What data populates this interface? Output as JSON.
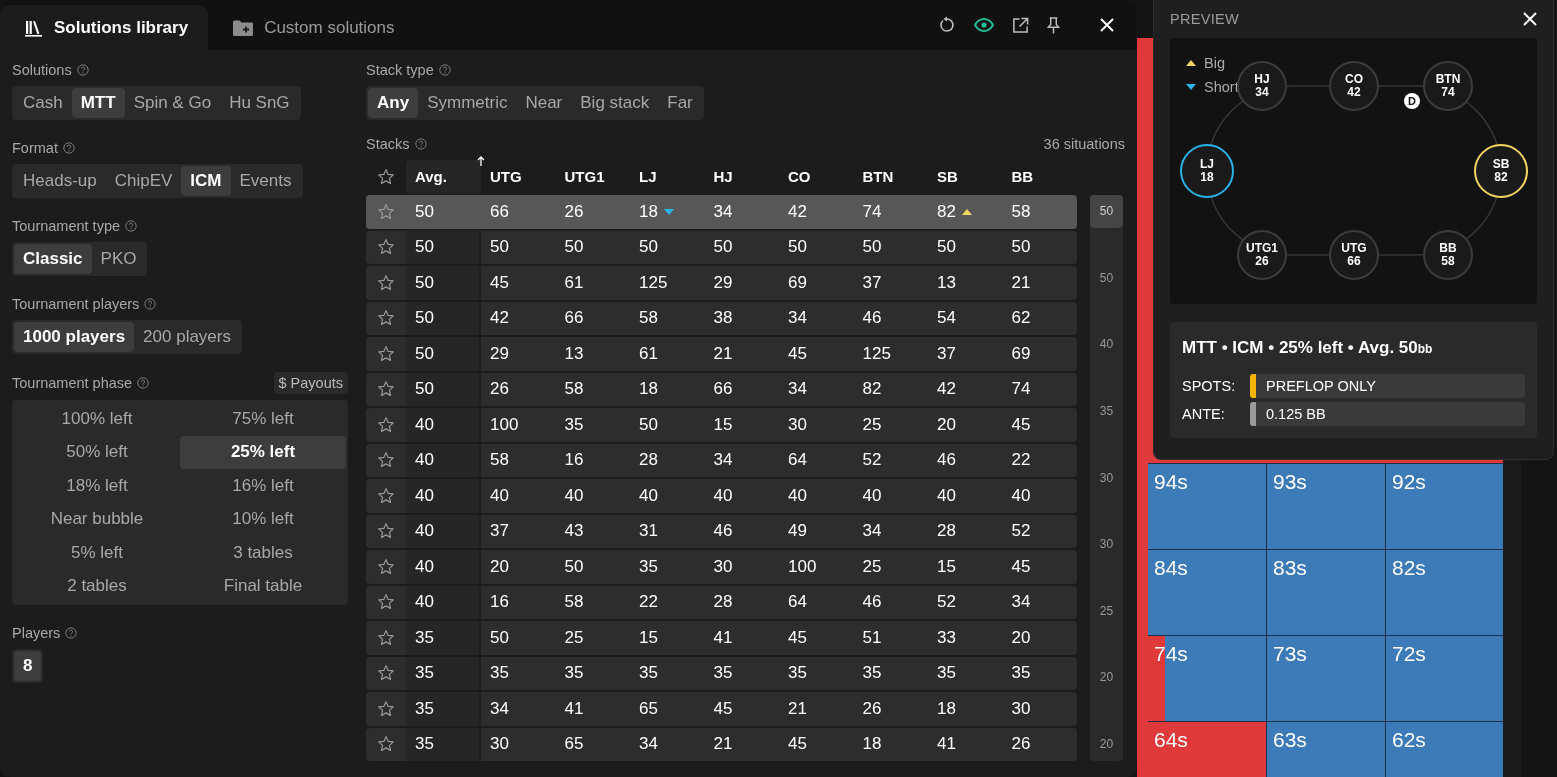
{
  "window": {
    "tabs": [
      {
        "label": "Solutions library",
        "kind": "library",
        "selected": true
      },
      {
        "label": "Custom solutions",
        "kind": "folder",
        "selected": false
      }
    ],
    "toolbar": [
      {
        "kind": "reset",
        "on": false
      },
      {
        "kind": "eye",
        "on": true
      },
      {
        "kind": "external",
        "on": false
      },
      {
        "kind": "pin",
        "on": false
      }
    ]
  },
  "filters": [
    {
      "label": "Solutions",
      "kind": "segmented",
      "options": [
        {
          "label": "Cash",
          "selected": false
        },
        {
          "label": "MTT",
          "selected": true
        },
        {
          "label": "Spin & Go",
          "selected": false
        },
        {
          "label": "Hu SnG",
          "selected": false
        }
      ]
    },
    {
      "label": "Format",
      "kind": "segmented",
      "options": [
        {
          "label": "Heads-up",
          "selected": false
        },
        {
          "label": "ChipEV",
          "selected": false
        },
        {
          "label": "ICM",
          "selected": true
        },
        {
          "label": "Events",
          "selected": false
        }
      ]
    },
    {
      "label": "Tournament type",
      "kind": "segmented",
      "options": [
        {
          "label": "Classic",
          "selected": true
        },
        {
          "label": "PKO",
          "selected": false
        }
      ]
    },
    {
      "label": "Tournament players",
      "kind": "segmented",
      "options": [
        {
          "label": "1000 players",
          "selected": true
        },
        {
          "label": "200 players",
          "selected": false
        }
      ]
    },
    {
      "label": "Tournament phase",
      "kind": "grid",
      "button": "$ Payouts",
      "options": [
        {
          "label": "100% left",
          "selected": false
        },
        {
          "label": "75% left",
          "selected": false
        },
        {
          "label": "50% left",
          "selected": false
        },
        {
          "label": "25% left",
          "selected": true
        },
        {
          "label": "18% left",
          "selected": false
        },
        {
          "label": "16% left",
          "selected": false
        },
        {
          "label": "Near bubble",
          "selected": false
        },
        {
          "label": "10% left",
          "selected": false
        },
        {
          "label": "5% left",
          "selected": false
        },
        {
          "label": "3 tables",
          "selected": false
        },
        {
          "label": "2 tables",
          "selected": false
        },
        {
          "label": "Final table",
          "selected": false
        }
      ]
    },
    {
      "label": "Players",
      "kind": "segmented",
      "options": [
        {
          "label": "8",
          "selected": true
        }
      ]
    }
  ],
  "stack_type": {
    "label": "Stack type",
    "options": [
      {
        "label": "Any",
        "selected": true
      },
      {
        "label": "Symmetric",
        "selected": false
      },
      {
        "label": "Near",
        "selected": false
      },
      {
        "label": "Big stack",
        "selected": false
      },
      {
        "label": "Far",
        "selected": false
      }
    ]
  },
  "stacks_table": {
    "label": "Stacks",
    "count": "36 situations",
    "columns": [
      "Avg.",
      "UTG",
      "UTG1",
      "LJ",
      "HJ",
      "CO",
      "BTN",
      "SB",
      "BB"
    ],
    "rows": [
      {
        "selected": true,
        "cells": [
          "50",
          "66",
          "26",
          {
            "value": "18",
            "short": true
          },
          "34",
          "42",
          "74",
          {
            "value": "82",
            "big": true
          },
          "58"
        ]
      },
      {
        "selected": false,
        "cells": [
          "50",
          "50",
          "50",
          "50",
          "50",
          "50",
          "50",
          "50",
          "50"
        ]
      },
      {
        "selected": false,
        "cells": [
          "50",
          "45",
          "61",
          "125",
          "29",
          "69",
          "37",
          "13",
          "21"
        ]
      },
      {
        "selected": false,
        "cells": [
          "50",
          "42",
          "66",
          "58",
          "38",
          "34",
          "46",
          "54",
          "62"
        ]
      },
      {
        "selected": false,
        "cells": [
          "50",
          "29",
          "13",
          "61",
          "21",
          "45",
          "125",
          "37",
          "69"
        ]
      },
      {
        "selected": false,
        "cells": [
          "50",
          "26",
          "58",
          "18",
          "66",
          "34",
          "82",
          "42",
          "74"
        ]
      },
      {
        "selected": false,
        "cells": [
          "40",
          "100",
          "35",
          "50",
          "15",
          "30",
          "25",
          "20",
          "45"
        ]
      },
      {
        "selected": false,
        "cells": [
          "40",
          "58",
          "16",
          "28",
          "34",
          "64",
          "52",
          "46",
          "22"
        ]
      },
      {
        "selected": false,
        "cells": [
          "40",
          "40",
          "40",
          "40",
          "40",
          "40",
          "40",
          "40",
          "40"
        ]
      },
      {
        "selected": false,
        "cells": [
          "40",
          "37",
          "43",
          "31",
          "46",
          "49",
          "34",
          "28",
          "52"
        ]
      },
      {
        "selected": false,
        "cells": [
          "40",
          "20",
          "50",
          "35",
          "30",
          "100",
          "25",
          "15",
          "45"
        ]
      },
      {
        "selected": false,
        "cells": [
          "40",
          "16",
          "58",
          "22",
          "28",
          "64",
          "46",
          "52",
          "34"
        ]
      },
      {
        "selected": false,
        "cells": [
          "35",
          "50",
          "25",
          "15",
          "41",
          "45",
          "51",
          "33",
          "20"
        ]
      },
      {
        "selected": false,
        "cells": [
          "35",
          "35",
          "35",
          "35",
          "35",
          "35",
          "35",
          "35",
          "35"
        ]
      },
      {
        "selected": false,
        "cells": [
          "35",
          "34",
          "41",
          "65",
          "45",
          "21",
          "26",
          "18",
          "30"
        ]
      },
      {
        "selected": false,
        "cells": [
          "35",
          "30",
          "65",
          "34",
          "21",
          "45",
          "18",
          "41",
          "26"
        ]
      }
    ],
    "scroll_labels": [
      {
        "label": "50",
        "selected": true
      },
      {
        "label": "50",
        "selected": false
      },
      {
        "label": "40",
        "selected": false
      },
      {
        "label": "35",
        "selected": false
      },
      {
        "label": "30",
        "selected": false
      },
      {
        "label": "30",
        "selected": false
      },
      {
        "label": "25",
        "selected": false
      },
      {
        "label": "20",
        "selected": false
      },
      {
        "label": "20",
        "selected": false
      }
    ]
  },
  "range_grid": {
    "cells": [
      {
        "label": "94s",
        "level": 0
      },
      {
        "label": "93s",
        "level": 0
      },
      {
        "label": "92s",
        "level": 0
      },
      {
        "label": "84s",
        "level": 0
      },
      {
        "label": "83s",
        "level": 0
      },
      {
        "label": "82s",
        "level": 0
      },
      {
        "label": "74s",
        "level": 0.14
      },
      {
        "label": "73s",
        "level": 0
      },
      {
        "label": "72s",
        "level": 0
      },
      {
        "label": "64s",
        "level": 1
      },
      {
        "label": "63s",
        "level": 0
      },
      {
        "label": "62s",
        "level": 0
      }
    ]
  },
  "preview": {
    "title": "PREVIEW",
    "legend": [
      {
        "label": "Big",
        "kind": "big"
      },
      {
        "label": "Short",
        "kind": "short"
      }
    ],
    "dealer_label": "D",
    "seats": [
      {
        "position": "HJ",
        "stack": "34",
        "short": false,
        "big": false,
        "dealer": false
      },
      {
        "position": "CO",
        "stack": "42",
        "short": false,
        "big": false,
        "dealer": false
      },
      {
        "position": "BTN",
        "stack": "74",
        "short": false,
        "big": false,
        "dealer": true
      },
      {
        "position": "LJ",
        "stack": "18",
        "short": true,
        "big": false,
        "dealer": false
      },
      {
        "position": "SB",
        "stack": "82",
        "short": false,
        "big": true,
        "dealer": false
      },
      {
        "position": "UTG1",
        "stack": "26",
        "short": false,
        "big": false,
        "dealer": false
      },
      {
        "position": "UTG",
        "stack": "66",
        "short": false,
        "big": false,
        "dealer": false
      },
      {
        "position": "BB",
        "stack": "58",
        "short": false,
        "big": false,
        "dealer": false
      }
    ],
    "summary": "MTT • ICM • 25% left • Avg. 50$_{bb}$",
    "details": [
      {
        "label": "SPOTS:",
        "value": "PREFLOP ONLY",
        "color": "#f5b400"
      },
      {
        "label": "ANTE:",
        "value": "0.125 BB",
        "color": "#9a9a9a"
      }
    ]
  }
}
